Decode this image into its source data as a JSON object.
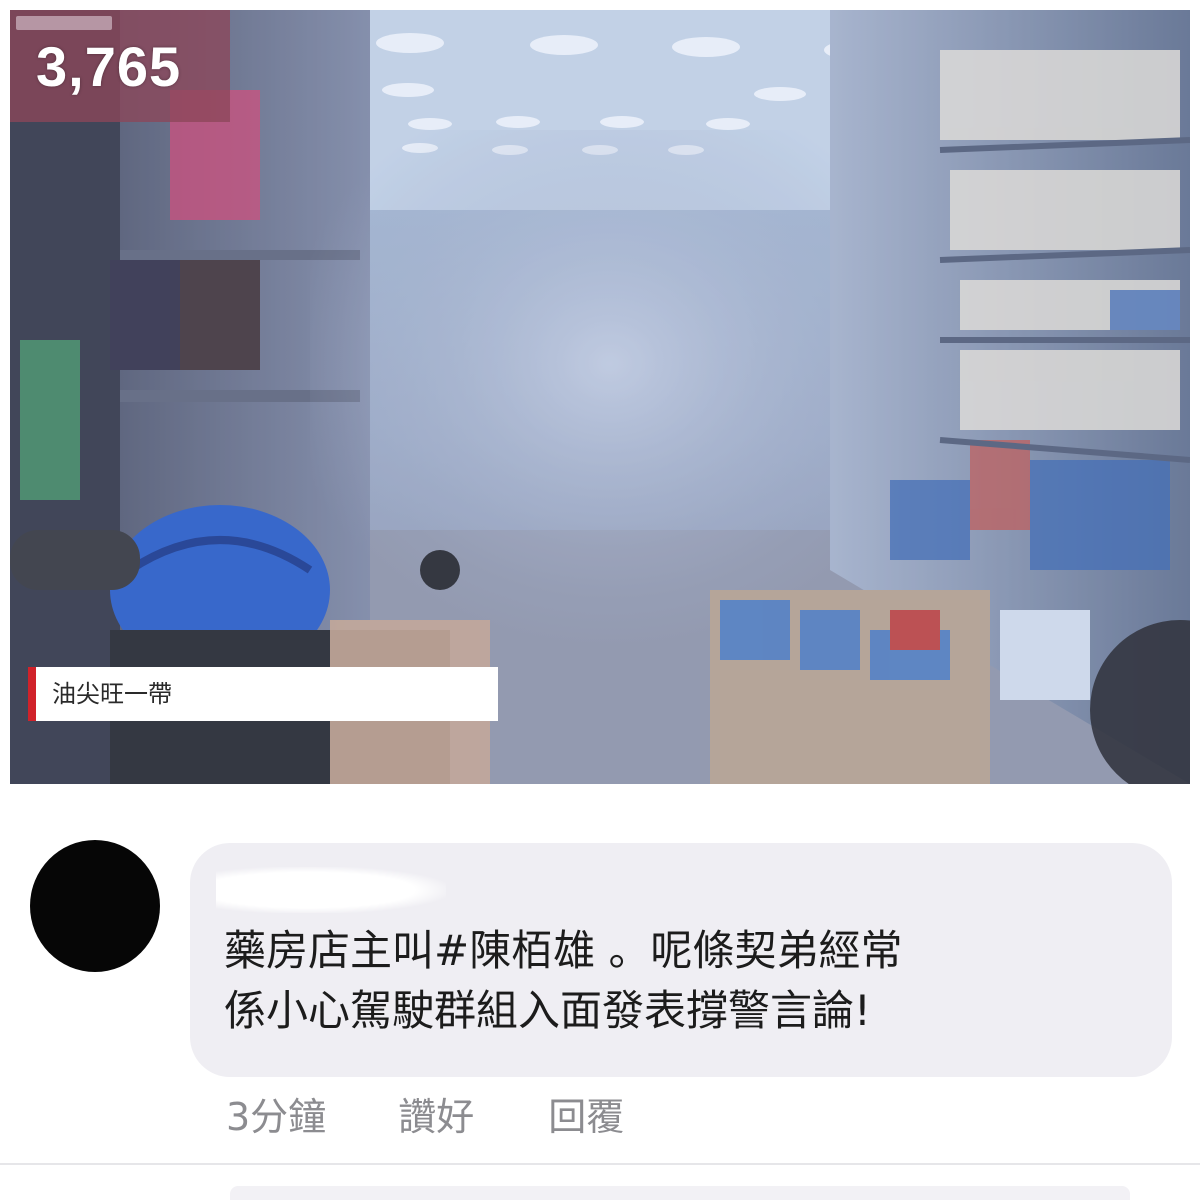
{
  "video": {
    "viewer_count": "3,765",
    "location_caption": "油尖旺一帶"
  },
  "comment": {
    "author": "",
    "text_lines": [
      "藥房店主叫#陳栢雄 。呢條契弟經常",
      "係小心駕駛群組入面發表撐警言論!"
    ],
    "timestamp": "3分鐘",
    "like_label": "讚好",
    "reply_label": "回覆"
  }
}
